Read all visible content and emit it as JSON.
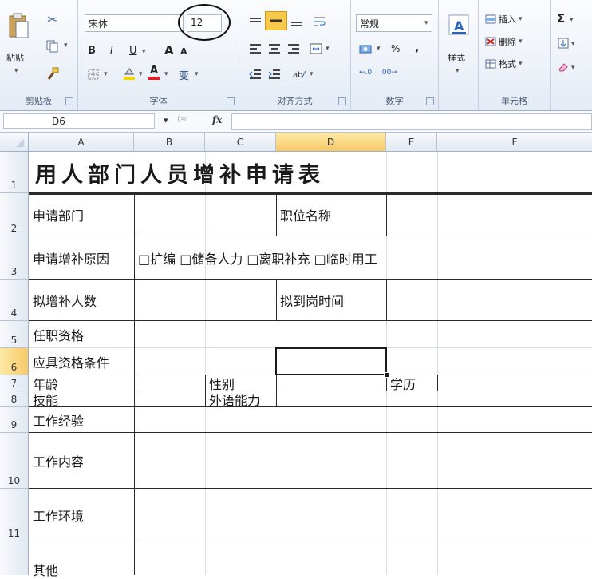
{
  "ribbon": {
    "clipboard": {
      "paste_label": "粘贴",
      "group_label": "剪贴板"
    },
    "font": {
      "name": "宋体",
      "size": "12",
      "bold": "B",
      "italic": "I",
      "underline": "U",
      "grow": "A",
      "shrink": "A",
      "font_color_glyph": "A",
      "wen": "变",
      "group_label": "字体"
    },
    "alignment": {
      "group_label": "对齐方式"
    },
    "number": {
      "format": "常规",
      "percent": "%",
      "comma": ",",
      "inc": ".0→.00",
      "dec": ".00→.0",
      "group_label": "数字"
    },
    "styles": {
      "label": "样式"
    },
    "cells": {
      "insert": "插入",
      "delete": "删除",
      "format": "格式",
      "group_label": "单元格"
    },
    "editing": {
      "sigma": "Σ"
    }
  },
  "formula_bar": {
    "name_box": "D6",
    "fx": "fx",
    "dropdown": "▾",
    "cancel": "(≈"
  },
  "columns": [
    "A",
    "B",
    "C",
    "D",
    "E",
    "F"
  ],
  "selected_cell": "D6",
  "rows": [
    {
      "num": "1",
      "cells": {
        "A": "用人部门人员增补申请表"
      }
    },
    {
      "num": "2",
      "cells": {
        "A": "申请部门",
        "D": "职位名称"
      }
    },
    {
      "num": "3",
      "cells": {
        "A": "申请增补原因",
        "B": "□扩编  □储备人力  □离职补充  □临时用工"
      }
    },
    {
      "num": "4",
      "cells": {
        "A": "拟增补人数",
        "D": "拟到岗时间"
      }
    },
    {
      "num": "5",
      "cells": {
        "A": "任职资格"
      }
    },
    {
      "num": "6",
      "cells": {
        "A": "应具资格条件"
      }
    },
    {
      "num": "7",
      "cells": {
        "A": "年龄",
        "C": "性别",
        "E": "学历"
      }
    },
    {
      "num": "8",
      "cells": {
        "A": "技能",
        "C": "外语能力"
      }
    },
    {
      "num": "9",
      "cells": {
        "A": "工作经验"
      }
    },
    {
      "num": "10",
      "cells": {
        "A": "工作内容"
      }
    },
    {
      "num": "11",
      "cells": {
        "A": "工作环境"
      }
    },
    {
      "num": "",
      "cells": {
        "A": "其他"
      }
    }
  ]
}
